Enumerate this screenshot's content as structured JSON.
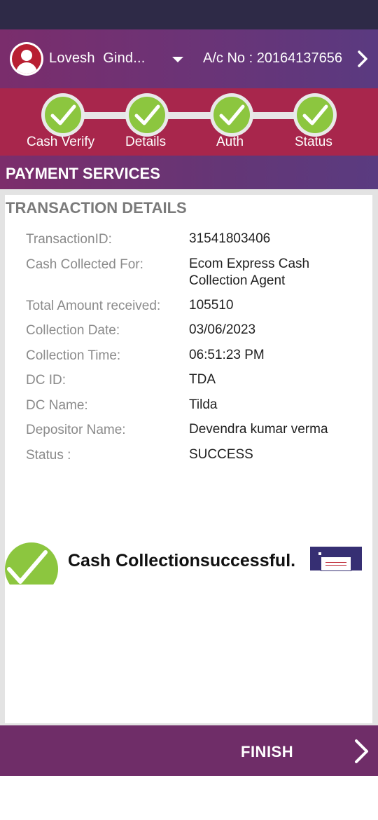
{
  "header": {
    "user_name": "Lovesh  Gind...",
    "account": "A/c No : 20164137656"
  },
  "stepper": {
    "steps": [
      {
        "label": "Cash Verify",
        "done": true
      },
      {
        "label": "Details",
        "done": true
      },
      {
        "label": "Auth",
        "done": true
      },
      {
        "label": "Status",
        "done": true
      }
    ]
  },
  "section": {
    "title": "PAYMENT SERVICES"
  },
  "details": {
    "title": "TRANSACTION DETAILS",
    "rows": [
      {
        "label": "TransactionID:",
        "value": "31541803406"
      },
      {
        "label": "Cash Collected For:",
        "value": "Ecom Express Cash Collection Agent"
      },
      {
        "label": "Total Amount received:",
        "value": "105510"
      },
      {
        "label": "Collection Date:",
        "value": "03/06/2023"
      },
      {
        "label": "Collection Time:",
        "value": "06:51:23 PM"
      },
      {
        "label": "DC ID:",
        "value": "TDA"
      },
      {
        "label": "DC Name:",
        "value": "Tilda"
      },
      {
        "label": "Depositor Name:",
        "value": "Devendra kumar verma"
      },
      {
        "label": "Status :",
        "value": "SUCCESS"
      }
    ]
  },
  "result": {
    "message": "Cash Collectionsuccessful.",
    "icons": [
      "check-icon",
      "printer-icon"
    ]
  },
  "footer": {
    "finish_label": "FINISH"
  },
  "colors": {
    "header_purple": "#6a3477",
    "stepper_red": "#a8264c",
    "check_green": "#8cc63f",
    "footer_purple": "#6f2d68",
    "status_bar": "#2e2a47"
  }
}
